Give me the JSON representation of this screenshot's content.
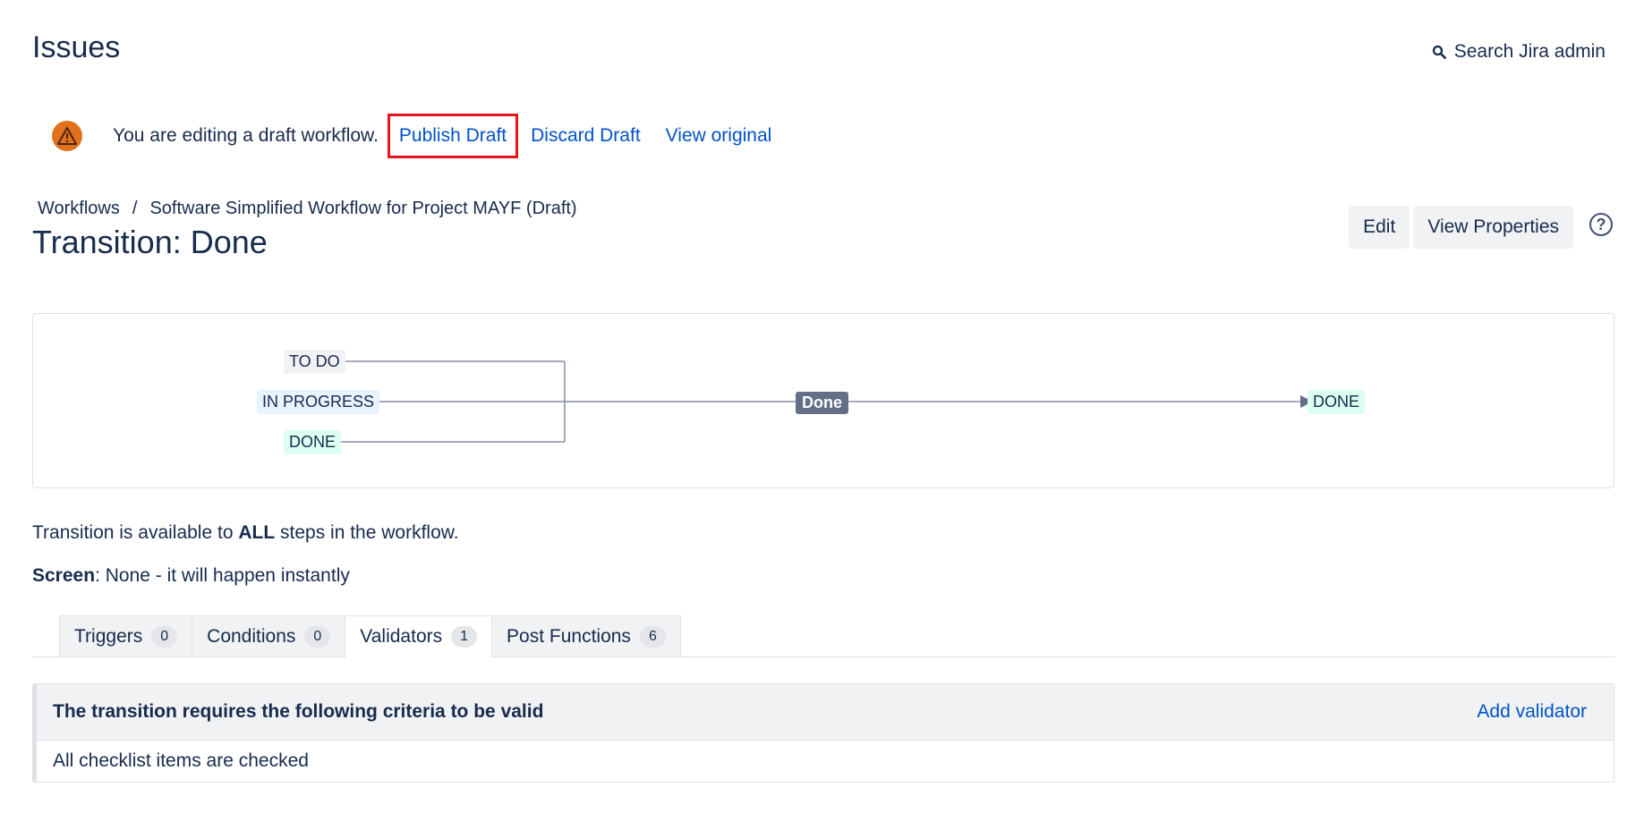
{
  "header": {
    "title": "Issues",
    "search_label": "Search Jira admin",
    "search_icon": "search-icon"
  },
  "draft_bar": {
    "message": "You are editing a draft workflow.",
    "publish": "Publish Draft",
    "discard": "Discard Draft",
    "view_original": "View original",
    "warning_color": "#e2711d",
    "highlight_color": "#e3141e"
  },
  "breadcrumb": {
    "workflows": "Workflows",
    "separator": "/",
    "current": "Software Simplified Workflow for Project MAYF (Draft)"
  },
  "page_title": "Transition: Done",
  "actions": {
    "edit": "Edit",
    "view_properties": "View Properties",
    "help": "?"
  },
  "diagram": {
    "sources": [
      "TO DO",
      "IN PROGRESS",
      "DONE"
    ],
    "transition": "Done",
    "target": "DONE"
  },
  "info": {
    "availability_prefix": "Transition is available to ",
    "availability_bold": "ALL",
    "availability_suffix": " steps in the workflow.",
    "screen_label": "Screen",
    "screen_value": ": None - it will happen instantly"
  },
  "tabs": [
    {
      "label": "Triggers",
      "count": "0"
    },
    {
      "label": "Conditions",
      "count": "0"
    },
    {
      "label": "Validators",
      "count": "1"
    },
    {
      "label": "Post Functions",
      "count": "6"
    }
  ],
  "validators": {
    "header": "The transition requires the following criteria to be valid",
    "add": "Add validator",
    "items": [
      "All checklist items are checked"
    ]
  }
}
